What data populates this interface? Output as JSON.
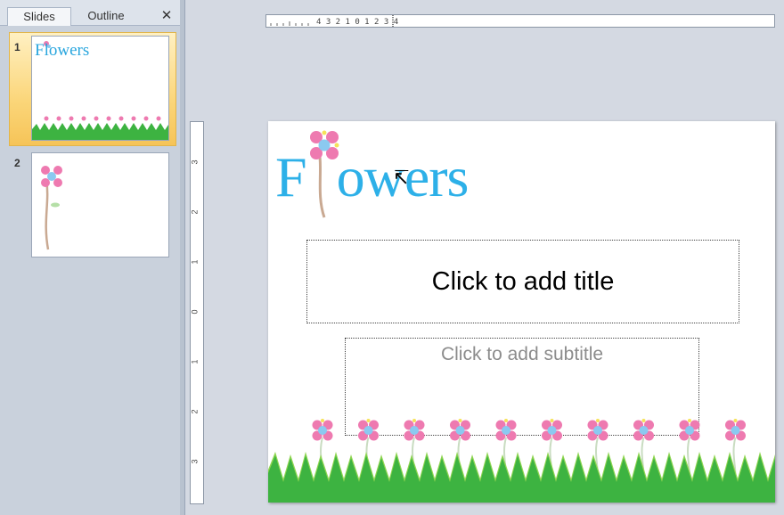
{
  "left_panel": {
    "tabs": [
      {
        "label": "Slides",
        "active": true
      },
      {
        "label": "Outline",
        "active": false
      }
    ],
    "close_glyph": "✕",
    "thumbnails": [
      {
        "number": "1",
        "title": "Flowers",
        "selected": true
      },
      {
        "number": "2",
        "selected": false
      }
    ]
  },
  "ruler": {
    "horizontal": "4 3 2 1 0 1 2 3 4",
    "vertical": [
      "3",
      "2",
      "1",
      "0",
      "1",
      "2",
      "3"
    ]
  },
  "slide": {
    "logo_text": "Flowers",
    "title_placeholder": "Click to add title",
    "subtitle_placeholder": "Click to add subtitle"
  },
  "colors": {
    "accent_blue": "#2db0e8",
    "grass_green": "#3db341",
    "flower_pink": "#ee7ab0",
    "selection_gold": "#fbd67a"
  },
  "icons": {
    "close": "close-icon",
    "cursor": "mouse-pointer-icon",
    "flower": "flower-icon"
  }
}
